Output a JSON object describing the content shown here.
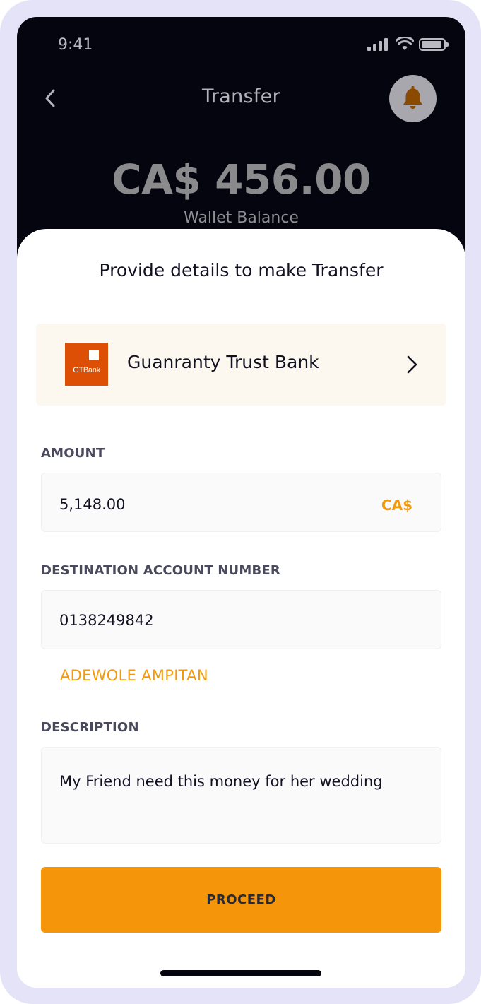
{
  "status_bar": {
    "time": "9:41"
  },
  "header": {
    "title": "Transfer",
    "balance": "CA$ 456.00",
    "balance_label": "Wallet Balance"
  },
  "sheet": {
    "title": "Provide details to make Transfer"
  },
  "bank": {
    "logo_text": "GTBank",
    "name": "Guanranty Trust Bank"
  },
  "amount": {
    "label": "AMOUNT",
    "value": "5,148.00",
    "currency": "CA$"
  },
  "destination": {
    "label": "DESTINATION ACCOUNT NUMBER",
    "value": "0138249842",
    "account_name": "ADEWOLE AMPITAN"
  },
  "description": {
    "label": "DESCRIPTION",
    "value": "My Friend need this money for her wedding"
  },
  "actions": {
    "proceed_label": "PROCEED"
  },
  "colors": {
    "accent": "#f5960a",
    "accent_text": "#f29a0e",
    "header_bg": "#05050f",
    "bank_brand": "#dd4f05",
    "bell_icon": "#8a4a00"
  }
}
